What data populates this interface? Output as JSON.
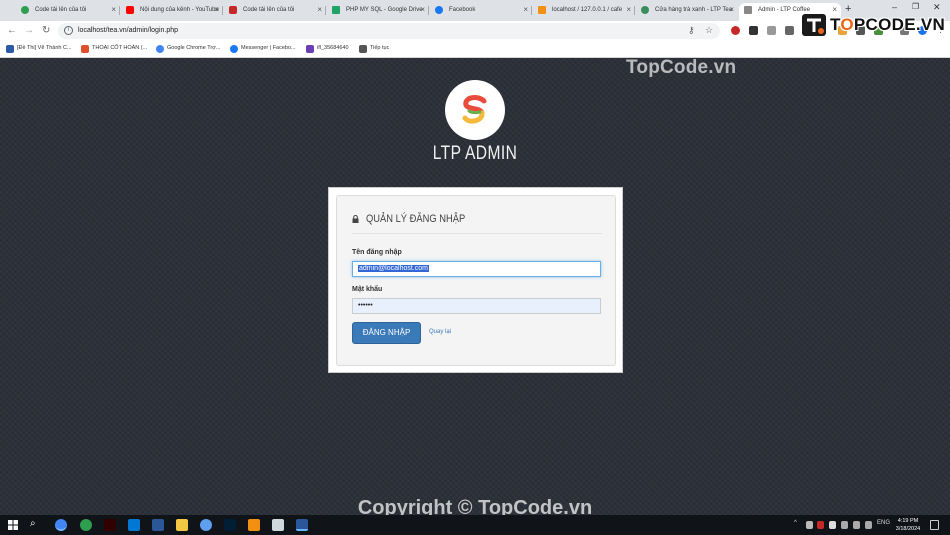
{
  "browser": {
    "tabs": [
      {
        "title": "Code tải lên của tôi",
        "favicon_color": "#2e9e4f"
      },
      {
        "title": "Nội dung của kênh - YouTube",
        "favicon_color": "#ff0000"
      },
      {
        "title": "Code tải lên của tôi",
        "favicon_color": "#c62828"
      },
      {
        "title": "PHP MY SQL - Google Drive",
        "favicon_color": "#1fa463"
      },
      {
        "title": "Facebook",
        "favicon_color": "#1877f2"
      },
      {
        "title": "localhost / 127.0.0.1 / cafe",
        "favicon_color": "#f29111"
      },
      {
        "title": "Cửa hàng trà xanh - LTP Tea",
        "favicon_color": "#3a8d5c"
      },
      {
        "title": "Admin - LTP Coffee",
        "favicon_color": "#888888"
      }
    ],
    "url": "localhost/tea.vn/admin/login.php",
    "bookmarks": [
      {
        "label": "[Đề Thi] Vẽ Thành C...",
        "color": "#2b5aa8"
      },
      {
        "label": "THOẠI CỐT HOÀN (...",
        "color": "#e04e2c"
      },
      {
        "label": "Google Chrome Trợ...",
        "color": "#4285f4"
      },
      {
        "label": "Messenger | Facebo...",
        "color": "#1877f2"
      },
      {
        "label": "ifl_35684640",
        "color": "#6a3fb5"
      },
      {
        "label": "Tiếp tục",
        "color": "#555555"
      }
    ]
  },
  "watermark": {
    "top": "TopCode.vn",
    "bottom": "Copyright © TopCode.vn",
    "brand_prefix": "T",
    "brand_o": "O",
    "brand_rest": "PCODE.VN"
  },
  "login": {
    "app_title": "LTP ADMIN",
    "panel_title": "QUẢN LÝ ĐĂNG NHẬP",
    "username_label": "Tên đăng nhập",
    "username_value": "admin@localhost.com",
    "password_label": "Mật khẩu",
    "password_value": "••••••",
    "submit_label": "ĐĂNG NHẬP",
    "back_link": "Quay lại",
    "accent_color": "#3a7ab8"
  },
  "taskbar": {
    "language": "ENG",
    "time": "4:19 PM",
    "date": "3/18/2024"
  }
}
